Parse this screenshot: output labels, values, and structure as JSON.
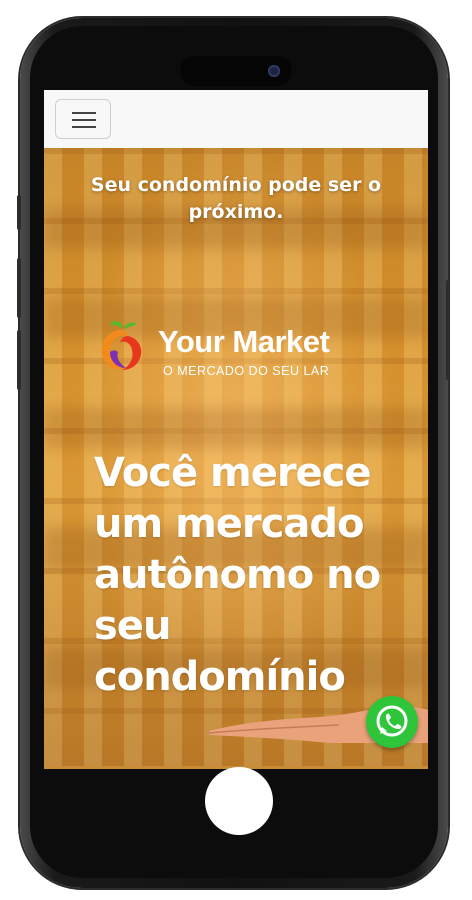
{
  "header": {
    "menu_icon": "hamburger-menu-icon"
  },
  "hero": {
    "teaser_line1": "Seu condomínio pode ser o",
    "teaser_line2": "próximo.",
    "brand_name": "Your Market",
    "brand_tagline": "O MERCADO DO SEU LAR",
    "headline_lines": [
      "Você merece",
      "um mercado",
      "autônomo no",
      "seu",
      "condomínio"
    ]
  },
  "floating": {
    "whatsapp_icon": "whatsapp-icon"
  },
  "colors": {
    "hero_orange": "#d9962f",
    "whatsapp_green": "#2fc53b",
    "logo_orange": "#f28a1c",
    "logo_purple": "#7b2fb5",
    "logo_green": "#59b82e"
  }
}
